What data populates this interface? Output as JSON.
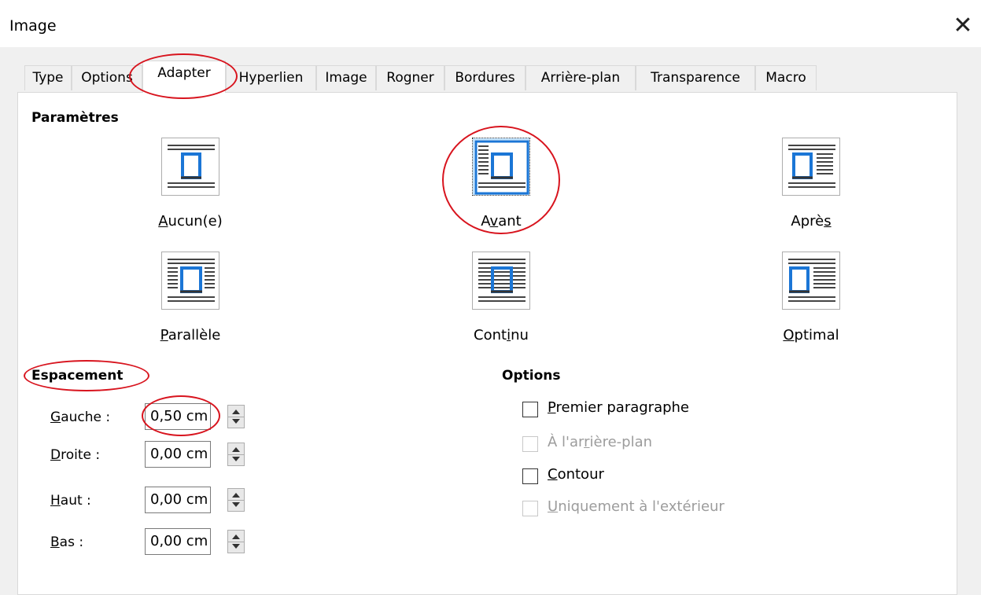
{
  "window": {
    "title": "Image"
  },
  "tabs": [
    "Type",
    "Options",
    "Adapter",
    "Hyperlien",
    "Image",
    "Rogner",
    "Bordures",
    "Arrière-plan",
    "Transparence",
    "Macro"
  ],
  "active_tab": "Adapter",
  "settings": {
    "title": "Paramètres",
    "wraps": [
      {
        "label": "Aucun(e)",
        "key": "A",
        "rest": "ucun(e)",
        "selected": false
      },
      {
        "label": "Avant",
        "pre": "A",
        "key": "v",
        "rest": "ant",
        "selected": true
      },
      {
        "label": "Après",
        "pre": "Aprè",
        "key": "s",
        "rest": "",
        "selected": false
      },
      {
        "label": "Parallèle",
        "key": "P",
        "rest": "arallèle",
        "selected": false
      },
      {
        "label": "Continu",
        "pre": "Cont",
        "key": "i",
        "rest": "nu",
        "selected": false
      },
      {
        "label": "Optimal",
        "key": "O",
        "rest": "ptimal",
        "selected": false
      }
    ]
  },
  "spacing": {
    "title": "Espacement",
    "rows": [
      {
        "label": "Gauche :",
        "key": "G",
        "rest": "auche :",
        "value": "0,50 cm"
      },
      {
        "label": "Droite :",
        "key": "D",
        "rest": "roite :",
        "value": "0,00 cm"
      },
      {
        "label": "Haut :",
        "key": "H",
        "rest": "aut :",
        "value": "0,00 cm"
      },
      {
        "label": "Bas :",
        "key": "B",
        "rest": "as :",
        "value": "0,00 cm"
      }
    ]
  },
  "options": {
    "title": "Options",
    "items": [
      {
        "label": "Premier paragraphe",
        "pre": "",
        "key": "P",
        "rest": "remier paragraphe",
        "checked": false,
        "enabled": true
      },
      {
        "label": "À l'arrière-plan",
        "pre": "À l'ar",
        "key": "r",
        "rest": "ière-plan",
        "checked": false,
        "enabled": false
      },
      {
        "label": "Contour",
        "pre": "",
        "key": "C",
        "rest": "ontour",
        "checked": false,
        "enabled": true
      },
      {
        "label": "Uniquement à l'extérieur",
        "pre": "",
        "key": "U",
        "rest": "niquement à l'extérieur",
        "checked": false,
        "enabled": false
      }
    ]
  },
  "colors": {
    "accent": "#1b76d6",
    "annotation": "#d8141e"
  },
  "icons": {
    "close": "close-icon"
  }
}
